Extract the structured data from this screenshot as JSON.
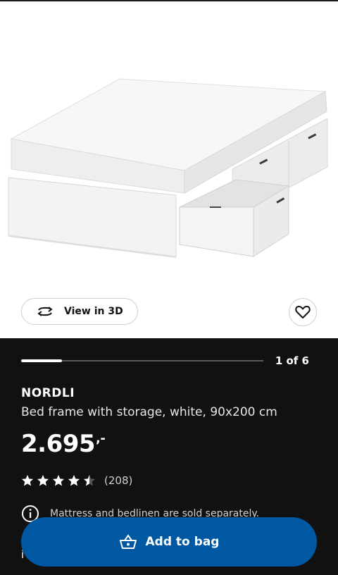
{
  "product_image": {
    "alt": "NORDLI bed frame with storage, white"
  },
  "actions": {
    "view3d_label": "View in 3D",
    "view3d_icon": "rotate-3d-icon",
    "favourite_icon": "heart-icon"
  },
  "gallery": {
    "current": 1,
    "total": 6,
    "counter_text": "1 of 6",
    "progress": 0.17
  },
  "product": {
    "name": "NORDLI",
    "description": "Bed frame with storage, white, 90x200 cm",
    "price": "2.695",
    "price_suffix": ",-",
    "rating_value": 4.5,
    "rating_max": 5,
    "review_count": "(208)"
  },
  "notice": {
    "icon": "info-icon",
    "text": "Mattress and bedlinen are sold separately."
  },
  "cta": {
    "label": "Add to bag",
    "icon": "basket-icon",
    "color": "#0058a3"
  },
  "cutoff_text": "i"
}
